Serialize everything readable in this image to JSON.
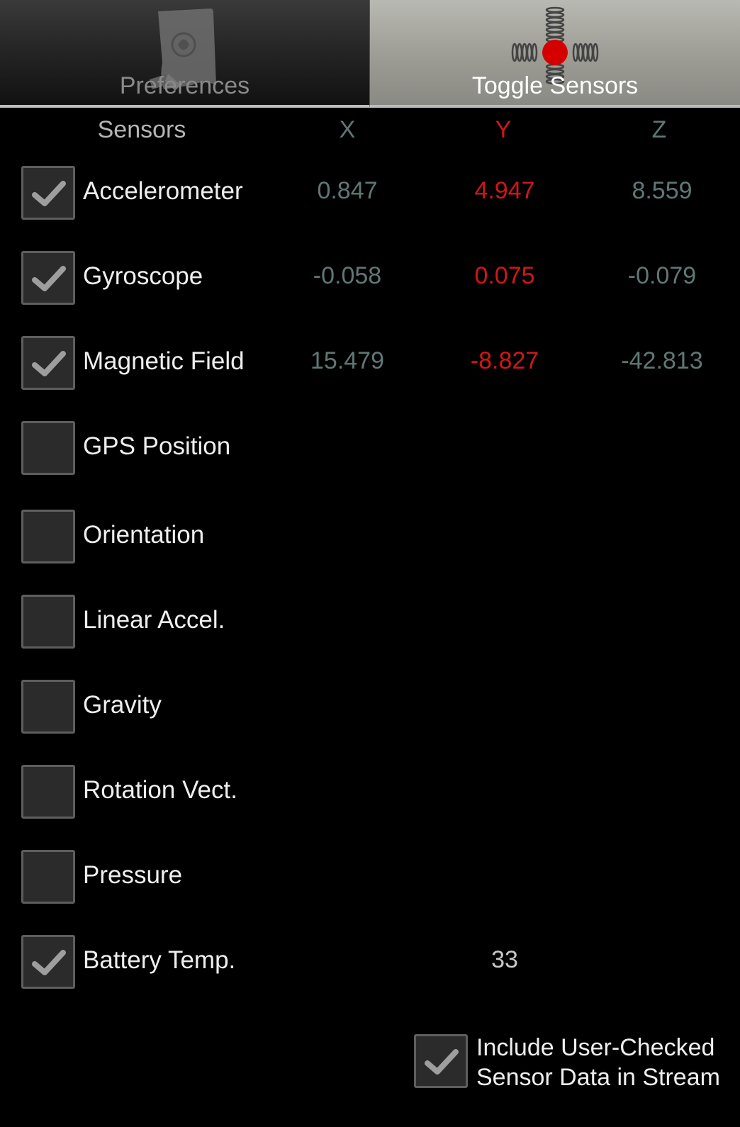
{
  "tabs": [
    {
      "label": "Preferences",
      "icon": "preferences-scroll-wrench-icon",
      "selected": false
    },
    {
      "label": "Toggle Sensors",
      "icon": "sensor-springs-icon",
      "selected": true
    }
  ],
  "header": {
    "sensors": "Sensors",
    "x": "X",
    "y": "Y",
    "z": "Z"
  },
  "sensors": [
    {
      "name": "Accelerometer",
      "checked": true,
      "x": "0.847",
      "y": "4.947",
      "z": "8.559"
    },
    {
      "name": "Gyroscope",
      "checked": true,
      "x": "-0.058",
      "y": "0.075",
      "z": "-0.079"
    },
    {
      "name": "Magnetic Field",
      "checked": true,
      "x": "15.479",
      "y": "-8.827",
      "z": "-42.813"
    },
    {
      "name": "GPS Position",
      "checked": false
    },
    {
      "name": "Orientation",
      "checked": false
    },
    {
      "name": "Linear Accel.",
      "checked": false
    },
    {
      "name": "Gravity",
      "checked": false
    },
    {
      "name": "Rotation Vect.",
      "checked": false
    },
    {
      "name": "Pressure",
      "checked": false
    },
    {
      "name": "Battery Temp.",
      "checked": true,
      "value": "33"
    }
  ],
  "include": {
    "line1": "Include User-Checked",
    "line2": "Sensor Data in Stream",
    "checked": true
  },
  "colors": {
    "x_value": "#5f7875",
    "y_value": "#d11616",
    "z_value": "#5f7875",
    "sensor_dot": "#d40000"
  }
}
